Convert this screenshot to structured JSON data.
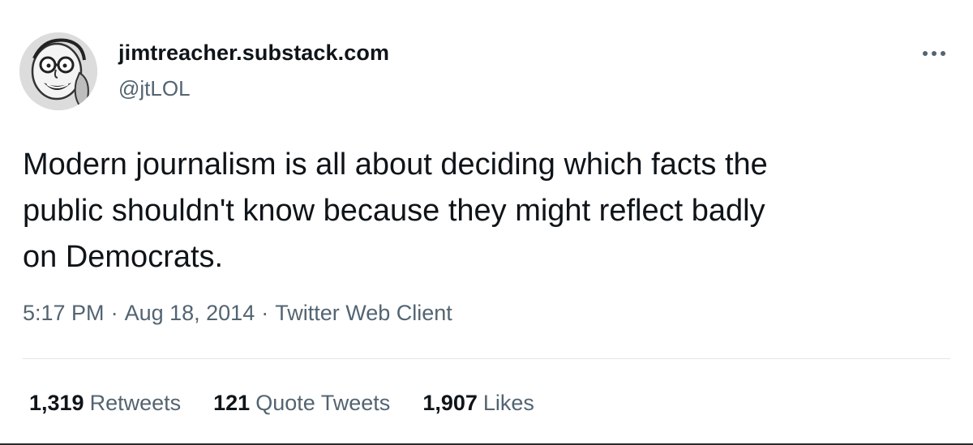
{
  "author": {
    "display_name": "jimtreacher.substack.com",
    "handle": "@jtLOL",
    "avatar_icon": "cartoon-face-avatar"
  },
  "more_icon": "more-horizontal-icon",
  "tweet": {
    "text": "Modern journalism is all about deciding which facts the\npublic shouldn't know because they might reflect badly\non Democrats."
  },
  "meta": {
    "time": "5:17 PM",
    "separator": "·",
    "date": "Aug 18, 2014",
    "client": "Twitter Web Client"
  },
  "stats": {
    "retweets": {
      "count": "1,319",
      "label": "Retweets"
    },
    "quote_tweets": {
      "count": "121",
      "label": "Quote Tweets"
    },
    "likes": {
      "count": "1,907",
      "label": "Likes"
    }
  },
  "colors": {
    "primary_text": "#0f1419",
    "secondary_text": "#536471",
    "divider": "#e1e6ea"
  }
}
